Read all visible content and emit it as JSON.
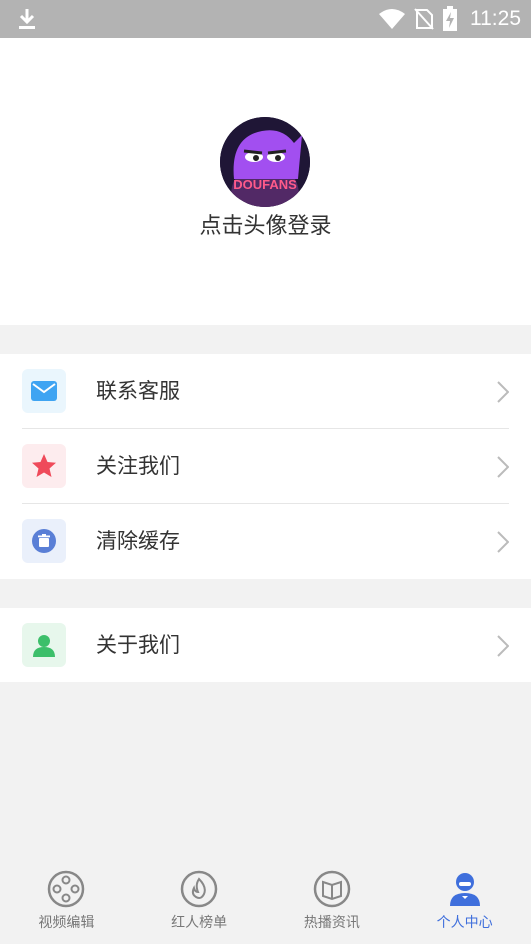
{
  "status_bar": {
    "time": "11:25"
  },
  "profile": {
    "login_prompt": "点击头像登录",
    "avatar_text": "DOUFANS"
  },
  "menu_group_1": [
    {
      "label": "联系客服",
      "icon": "mail-icon",
      "color": "#3fa4f2",
      "bg": "#eaf6fd"
    },
    {
      "label": "关注我们",
      "icon": "star-icon",
      "color": "#ef4a5a",
      "bg": "#fdecee"
    },
    {
      "label": "清除缓存",
      "icon": "trash-icon",
      "color": "#5a7fd6",
      "bg": "#eaf0fb"
    }
  ],
  "menu_group_2": [
    {
      "label": "关于我们",
      "icon": "user-icon",
      "color": "#3cbf6a",
      "bg": "#e7f7ec"
    }
  ],
  "bottom_nav": [
    {
      "label": "视频编辑",
      "icon": "film-reel-icon",
      "active": false
    },
    {
      "label": "红人榜单",
      "icon": "flame-icon",
      "active": false
    },
    {
      "label": "热播资讯",
      "icon": "book-icon",
      "active": false
    },
    {
      "label": "个人中心",
      "icon": "person-icon",
      "active": true
    }
  ],
  "colors": {
    "accent": "#3f6fdc",
    "inactive": "#777777"
  }
}
